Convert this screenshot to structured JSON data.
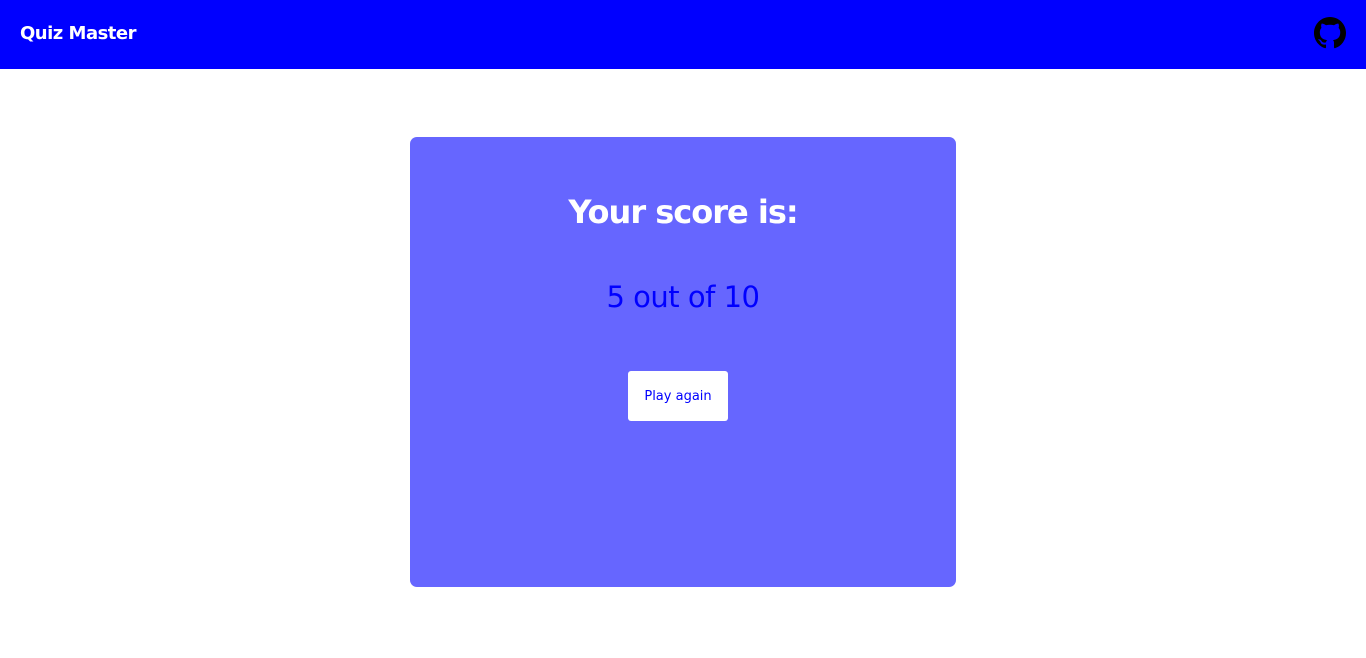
{
  "navbar": {
    "brand": "Quiz Master",
    "github_icon": "github-icon",
    "color": "#0000ff"
  },
  "result": {
    "title": "Your score is:",
    "score_text": "5 out of 10",
    "score": 5,
    "total": 10,
    "play_again_label": "Play again",
    "card_color": "#6666ff"
  }
}
